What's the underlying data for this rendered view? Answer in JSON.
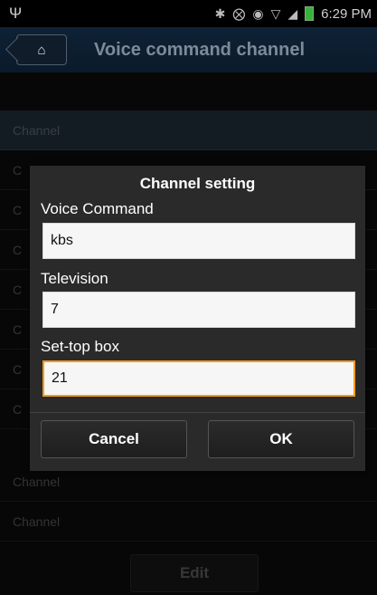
{
  "status_bar": {
    "usb_icon": "usb-icon",
    "icons": [
      "bluetooth-icon",
      "muted-icon",
      "alarm-icon",
      "wifi-icon",
      "signal-icon",
      "battery-icon"
    ],
    "time": "6:29 PM"
  },
  "title_bar": {
    "home_icon": "home-icon",
    "title": "Voice command channel"
  },
  "list": {
    "header": "Channel",
    "rows": [
      "C",
      "C",
      "C",
      "C",
      "C",
      "C",
      "C",
      "Channel",
      "Channel"
    ]
  },
  "edit_label": "Edit",
  "dialog": {
    "title": "Channel setting",
    "fields": [
      {
        "label": "Voice Command",
        "value": "kbs"
      },
      {
        "label": "Television",
        "value": "7"
      },
      {
        "label": "Set-top box",
        "value": "21"
      }
    ],
    "cancel_label": "Cancel",
    "ok_label": "OK"
  },
  "colors": {
    "focus_border": "#f29b1d",
    "battery": "#38b23a"
  }
}
